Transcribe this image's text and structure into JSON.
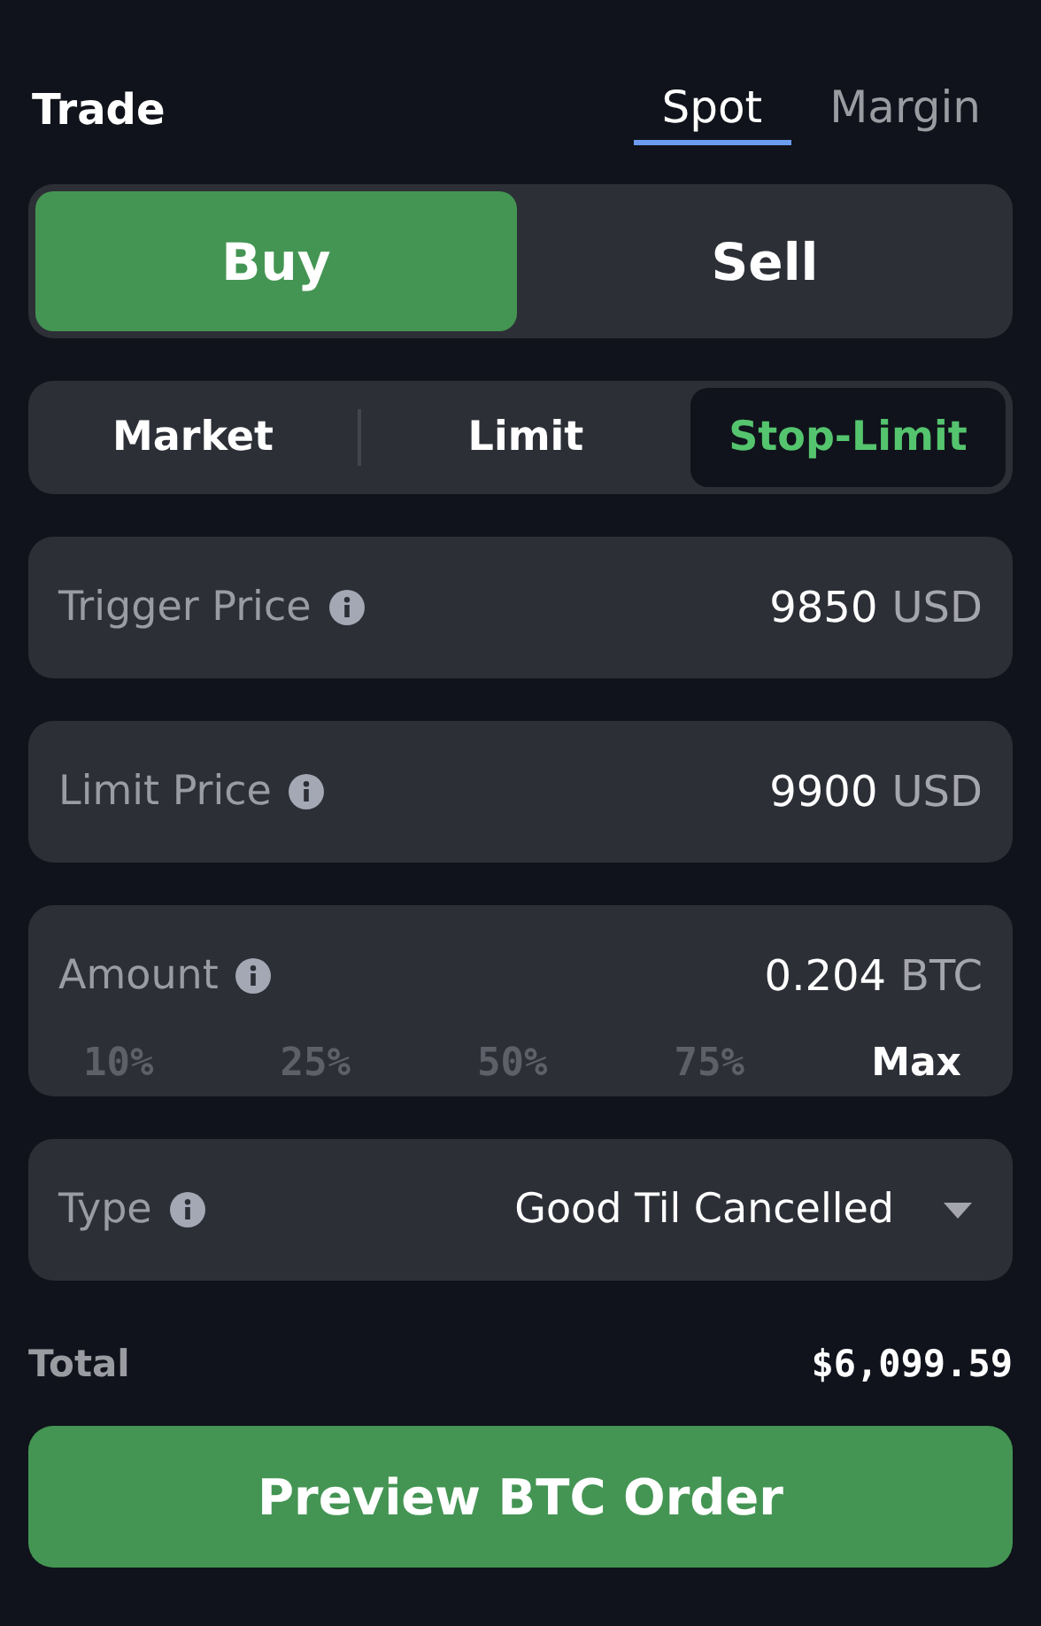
{
  "header": {
    "title": "Trade",
    "tabs": [
      {
        "label": "Spot",
        "selected": true
      },
      {
        "label": "Margin",
        "selected": false
      }
    ]
  },
  "sides": [
    {
      "label": "Buy",
      "selected": true
    },
    {
      "label": "Sell",
      "selected": false
    }
  ],
  "order_types": [
    {
      "label": "Market",
      "selected": false
    },
    {
      "label": "Limit",
      "selected": false
    },
    {
      "label": "Stop-Limit",
      "selected": true
    }
  ],
  "fields": [
    {
      "kind": "input",
      "label": "Trigger Price",
      "value": "9850",
      "unit": "USD"
    },
    {
      "kind": "input",
      "label": "Limit Price",
      "value": "9900",
      "unit": "USD"
    },
    {
      "kind": "amount",
      "label": "Amount",
      "value": "0.204",
      "unit": "BTC",
      "presets": [
        {
          "label": "10%",
          "selected": false
        },
        {
          "label": "25%",
          "selected": false
        },
        {
          "label": "50%",
          "selected": false
        },
        {
          "label": "75%",
          "selected": false
        },
        {
          "label": "Max",
          "selected": true
        }
      ]
    },
    {
      "kind": "select",
      "label": "Type",
      "value": "Good Til Cancelled"
    }
  ],
  "total": {
    "label": "Total",
    "value": "$6,099.59"
  },
  "submit": "Preview BTC Order"
}
